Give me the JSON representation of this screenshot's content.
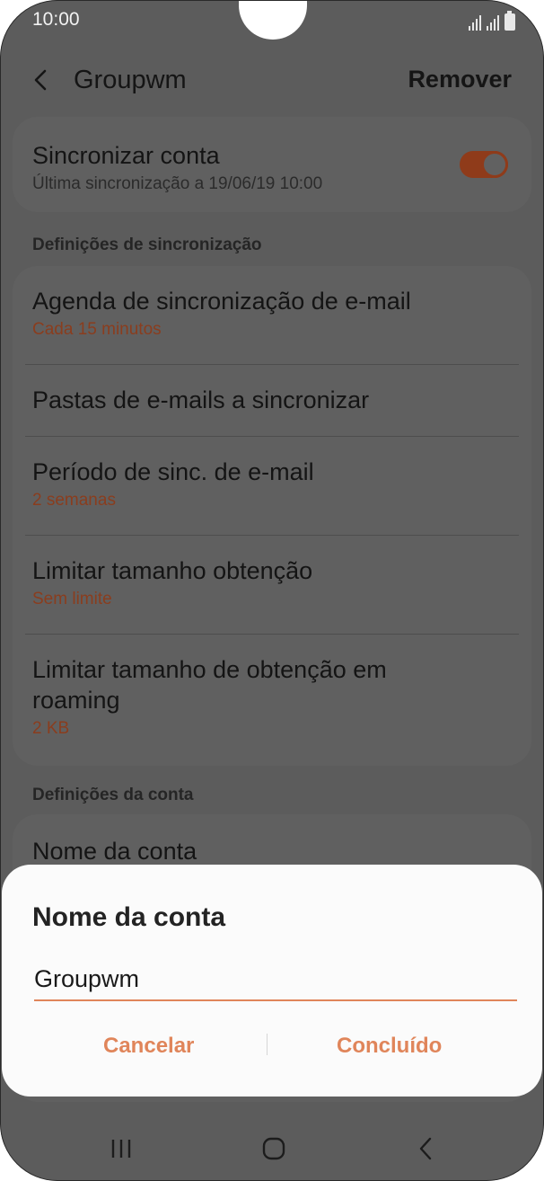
{
  "status_bar": {
    "time": "10:00"
  },
  "header": {
    "title": "Groupwm",
    "remove_label": "Remover"
  },
  "sync_account": {
    "title": "Sincronizar conta",
    "subtitle": "Última sincronização a 19/06/19  10:00",
    "enabled": true
  },
  "sync_section": {
    "heading": "Definições de sincronização",
    "items": [
      {
        "title": "Agenda de sincronização de e-mail",
        "value": "Cada 15 minutos"
      },
      {
        "title": "Pastas de e-mails a sincronizar"
      },
      {
        "title": "Período de sinc. de e-mail",
        "value": "2 semanas"
      },
      {
        "title": "Limitar tamanho obtenção",
        "value": "Sem limite"
      },
      {
        "title": "Limitar tamanho de obtenção em roaming",
        "value": "2 KB"
      }
    ]
  },
  "account_section": {
    "heading": "Definições da conta",
    "items": [
      {
        "title": "Nome da conta"
      }
    ]
  },
  "dialog": {
    "title": "Nome da conta",
    "input_value": "Groupwm",
    "cancel_label": "Cancelar",
    "done_label": "Concluído"
  },
  "nav_icons": [
    "recent-apps-icon",
    "home-icon",
    "back-icon"
  ],
  "colors": {
    "accent": "#e0855a",
    "scrim": "#5c5c5c",
    "dialog": "#fbfbfb"
  }
}
